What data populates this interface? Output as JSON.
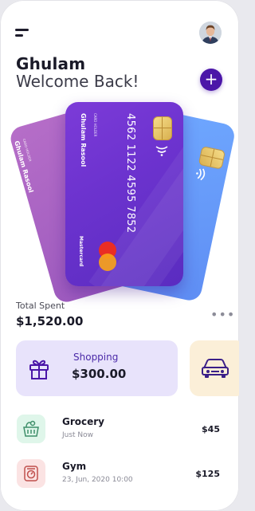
{
  "header": {
    "menu_icon": "hamburger-menu-icon",
    "avatar": "user-avatar"
  },
  "greeting": {
    "name": "Ghulam",
    "welcome": "Welcome Back!",
    "add_icon": "+"
  },
  "cards": {
    "main": {
      "holder_caption": "CARD HOLDER",
      "holder_name": "Ghulam Rasool",
      "number": "4562 1122 4595 7852",
      "brand": "Mastercard"
    },
    "back": {
      "holder_caption": "CARD HOLDER",
      "holder_name": "Ghulam Rasool"
    }
  },
  "summary": {
    "label": "Total Spent",
    "amount": "$1,520.00",
    "more_icon": "•••"
  },
  "categories": [
    {
      "title": "Shopping",
      "amount": "$300.00",
      "icon": "gift-icon"
    },
    {
      "title": "",
      "amount": "",
      "icon": "car-icon"
    }
  ],
  "transactions": [
    {
      "name": "Grocery",
      "time": "Just Now",
      "amount": "$45",
      "icon": "grocery-basket-icon"
    },
    {
      "name": "Gym",
      "time": "23, Jun, 2020 10:00",
      "amount": "$125",
      "icon": "gym-scale-icon"
    }
  ],
  "colors": {
    "accent": "#4b16a8",
    "card_main": "#6d33cf",
    "card_pink": "#a862c3",
    "card_blue": "#6b9dfc",
    "shopping_bg": "#e8e3fb",
    "car_bg": "#fbefd8",
    "grocery_bg": "#dff6ea",
    "gym_bg": "#fbe3e3"
  }
}
